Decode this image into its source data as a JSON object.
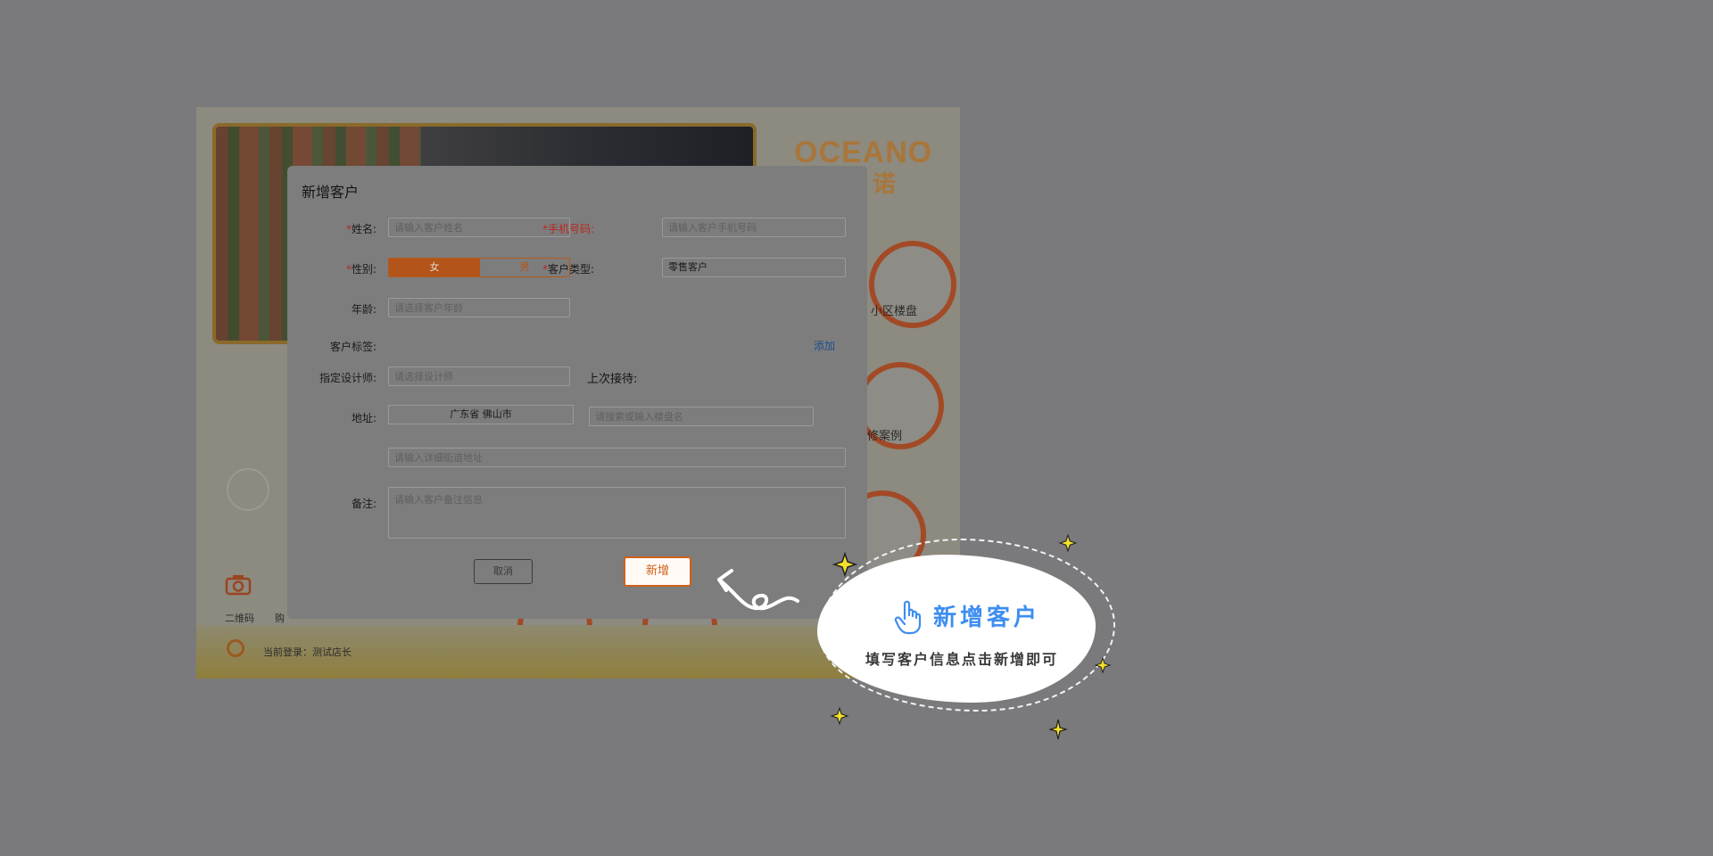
{
  "app": {
    "logo": "OCEANO",
    "logo_cn": "诺",
    "tiles": [
      {
        "label": "小区楼盘"
      },
      {
        "label": "修案例"
      }
    ],
    "bottom_items": [
      {
        "label": "二维码"
      },
      {
        "label": "购"
      }
    ],
    "login_text": "当前登录：测试店长"
  },
  "modal": {
    "title": "新增客户",
    "name": {
      "label": "姓名:",
      "placeholder": "请输入客户姓名"
    },
    "phone": {
      "label": "手机号码:",
      "placeholder": "请输入客户手机号码"
    },
    "gender": {
      "label": "性别:",
      "female": "女",
      "male": "男",
      "selected": "女"
    },
    "customer_type": {
      "label": "客户类型:",
      "value": "零售客户"
    },
    "age": {
      "label": "年龄:",
      "placeholder": "请选择客户年龄"
    },
    "tags": {
      "label": "客户标签:",
      "add": "添加"
    },
    "designer": {
      "label": "指定设计师:",
      "placeholder": "请选择设计师"
    },
    "last_reception": {
      "label": "上次接待:"
    },
    "address": {
      "label": "地址:",
      "region": "广东省 佛山市",
      "building_placeholder": "请搜索或输入楼盘名",
      "street_placeholder": "请输入详细街道地址"
    },
    "note": {
      "label": "备注:",
      "placeholder": "请输入客户备注信息"
    },
    "cancel": "取消",
    "submit": "新增",
    "required_mark": "*"
  },
  "tutorial": {
    "title": "新增客户",
    "text": "填写客户信息点击新增即可"
  },
  "colors": {
    "accent": "#d06018",
    "tutorial_blue": "#3d8ef0",
    "overlay": "#7a7a7c"
  }
}
